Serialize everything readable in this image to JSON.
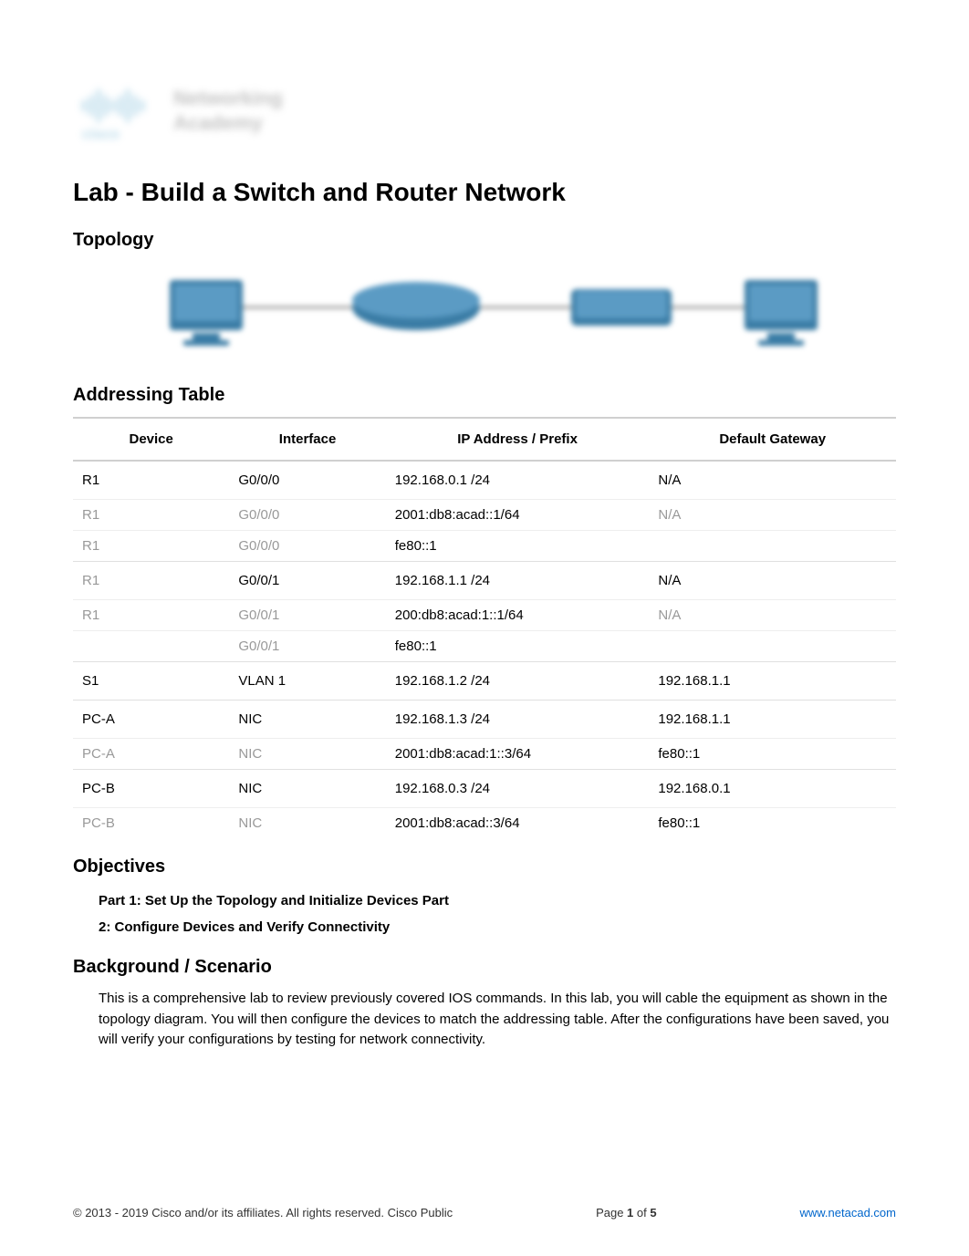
{
  "logo": {
    "brand": "cisco",
    "program_line1": "Networking",
    "program_line2": "Academy"
  },
  "title": "Lab - Build a Switch and Router Network",
  "sections": {
    "topology_heading": "Topology",
    "addressing_heading": "Addressing Table",
    "objectives_heading": "Objectives",
    "background_heading": "Background / Scenario"
  },
  "table": {
    "headers": {
      "device": "Device",
      "interface": "Interface",
      "ip": "IP Address / Prefix",
      "gateway": "Default Gateway"
    },
    "rows": [
      {
        "device": "R1",
        "interface": "G0/0/0",
        "ip": "192.168.0.1 /24",
        "gateway": "N/A"
      },
      {
        "device": "R1",
        "interface": "G0/0/0",
        "ip": "2001:db8:acad::1/64",
        "gateway": "N/A",
        "continued": true
      },
      {
        "device": "R1",
        "interface": "G0/0/0",
        "ip": "fe80::1",
        "gateway": "",
        "continued": true
      },
      {
        "device": "R1",
        "interface": "G0/0/1",
        "ip": "192.168.1.1 /24",
        "gateway": "N/A",
        "continued_device": true
      },
      {
        "device": "R1",
        "interface": "G0/0/1",
        "ip": "200:db8:acad:1::1/64",
        "gateway": "N/A",
        "continued": true
      },
      {
        "device": "",
        "interface": "G0/0/1",
        "ip": "fe80::1",
        "gateway": "",
        "continued": true,
        "interface_continued": true
      },
      {
        "device": "S1",
        "interface": "VLAN 1",
        "ip": "192.168.1.2 /24",
        "gateway": "192.168.1.1"
      },
      {
        "device": "PC-A",
        "interface": "NIC",
        "ip": "192.168.1.3 /24",
        "gateway": "192.168.1.1"
      },
      {
        "device": "PC-A",
        "interface": "NIC",
        "ip": "2001:db8:acad:1::3/64",
        "gateway": "fe80::1",
        "continued": true
      },
      {
        "device": "PC-B",
        "interface": "NIC",
        "ip": "192.168.0.3 /24",
        "gateway": "192.168.0.1"
      },
      {
        "device": "PC-B",
        "interface": "NIC",
        "ip": "2001:db8:acad::3/64",
        "gateway": "fe80::1",
        "continued": true
      }
    ]
  },
  "objectives": {
    "part1": "Part 1: Set Up the Topology and Initialize Devices Part",
    "part2": "2: Configure Devices and Verify Connectivity"
  },
  "scenario_text": "This is a comprehensive lab to review previously covered IOS commands. In this lab, you will cable the equipment as shown in the topology diagram. You will then configure the devices to match the addressing table. After the configurations have been saved, you will verify your configurations by testing for network connectivity.",
  "footer": {
    "copyright_symbol": "©",
    "copyright": " 2013 - 2019 Cisco and/or its affiliates. All rights reserved. Cisco Public",
    "page_label": "Page ",
    "page_current": "1",
    "page_sep": " of ",
    "page_total": "5",
    "url": "www.netacad.com"
  }
}
